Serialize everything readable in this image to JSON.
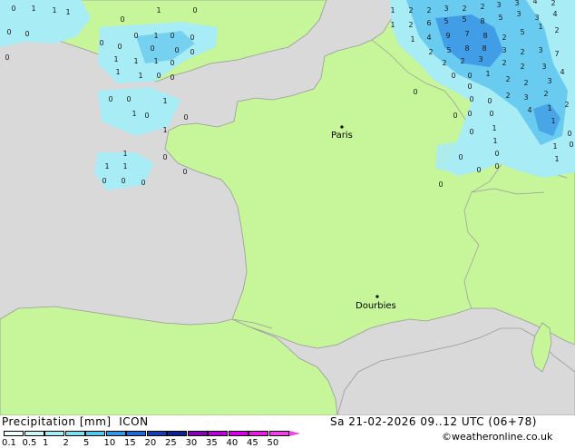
{
  "map": {
    "cities": [
      {
        "name": "Paris"
      },
      {
        "name": "Dourbies"
      }
    ],
    "colors": {
      "sea": "#d9d9d9",
      "land": "#c6f59a",
      "light_precip": "#a8ecf5",
      "medium_precip": "#69cbf0",
      "heavy_precip": "#3b95e3"
    }
  },
  "footer": {
    "title": "Precipitation [mm]",
    "model": "ICON",
    "datetime": "Sa 21-02-2026 09..12 UTC (06+78)",
    "credit": "©weatheronline.co.uk",
    "legend": {
      "labels": [
        "0.1",
        "0.5",
        "1",
        "2",
        "5",
        "10",
        "15",
        "20",
        "25",
        "30",
        "35",
        "40",
        "45",
        "50"
      ],
      "colors": [
        "#f0fdfd",
        "#cdf6f8",
        "#a6edf6",
        "#7ddff2",
        "#53c8ee",
        "#3399e6",
        "#2269d6",
        "#1540b4",
        "#0c2490",
        "#8a00b8",
        "#b800d8",
        "#d800e8",
        "#e81ce0",
        "#f040e8"
      ]
    }
  }
}
